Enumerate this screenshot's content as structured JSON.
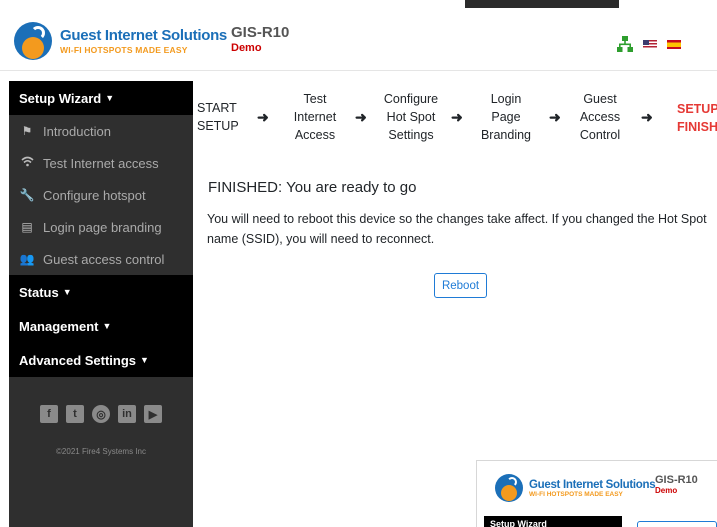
{
  "header": {
    "logo_title": "Guest Internet Solutions",
    "logo_subtitle": "WI-FI HOTSPOTS MADE EASY",
    "model": "GIS-R10",
    "mode": "Demo",
    "icons": [
      "network-icon",
      "flag-us-icon",
      "flag-es-icon"
    ]
  },
  "sidebar": {
    "setup_wizard": "Setup Wizard",
    "items": [
      {
        "label": "Introduction",
        "icon": "flag-icon"
      },
      {
        "label": "Test Internet access",
        "icon": "wifi-icon"
      },
      {
        "label": "Configure hotspot",
        "icon": "wrench-icon"
      },
      {
        "label": "Login page branding",
        "icon": "id-card-icon"
      },
      {
        "label": "Guest access control",
        "icon": "users-icon"
      }
    ],
    "status": "Status",
    "management": "Management",
    "advanced": "Advanced Settings",
    "social": [
      "facebook-icon",
      "twitter-icon",
      "instagram-icon",
      "linkedin-icon",
      "youtube-icon"
    ],
    "copyright": "©2021 Fire4 Systems Inc"
  },
  "steps": [
    {
      "lines": [
        "START",
        "SETUP"
      ]
    },
    {
      "lines": [
        "Test",
        "Internet",
        "Access"
      ]
    },
    {
      "lines": [
        "Configure",
        "Hot Spot",
        "Settings"
      ]
    },
    {
      "lines": [
        "Login",
        "Page",
        "Branding"
      ]
    },
    {
      "lines": [
        "Guest",
        "Access",
        "Control"
      ]
    },
    {
      "lines": [
        "SETUP",
        "FINISH"
      ]
    }
  ],
  "main": {
    "heading": "FINISHED: You are ready to go",
    "message": "You will need to reboot this device so the changes take affect. If you changed the Hot Spot name (SSID), you will need to reconnect.",
    "reboot_label": "Reboot"
  },
  "thumbnail": {
    "logo_title": "Guest Internet Solutions",
    "logo_subtitle": "WI-FI HOTSPOTS MADE EASY",
    "model": "GIS-R10",
    "mode": "Demo",
    "sidebar_label": "Setup Wizard"
  },
  "colors": {
    "accent": "#1f7bd6",
    "active_step": "#e53935",
    "sidebar_bg": "#2f2f2f",
    "section_bg": "#000000"
  }
}
